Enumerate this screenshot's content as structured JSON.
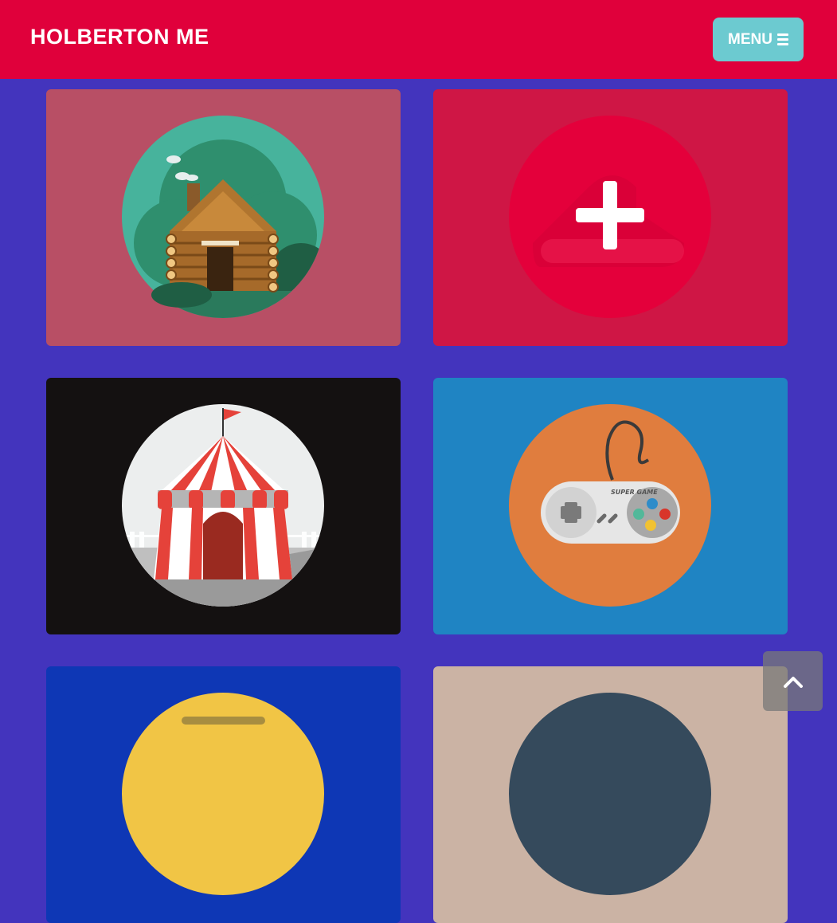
{
  "header": {
    "brand": "HOLBERTON ME",
    "menu_label": "MENU",
    "menu_icon": "bars-icon"
  },
  "cards": [
    {
      "icon": "log-cabin-icon",
      "bg": "#b84f65"
    },
    {
      "icon": "add-plus-icon",
      "bg": "#cf1645"
    },
    {
      "icon": "circus-tent-icon",
      "bg": "#141111"
    },
    {
      "icon": "game-controller-icon",
      "bg": "#1f84c3",
      "controller_text": "SUPER GAME"
    },
    {
      "icon": "yellow-circle-icon",
      "bg": "#0e37b5"
    },
    {
      "icon": "dark-circle-icon",
      "bg": "#cbb3a4"
    }
  ],
  "scroll_top": {
    "icon": "chevron-up-icon"
  },
  "colors": {
    "navbar": "#e0003b",
    "page_bg": "#4334bd",
    "menu_button": "#6ccad0"
  }
}
